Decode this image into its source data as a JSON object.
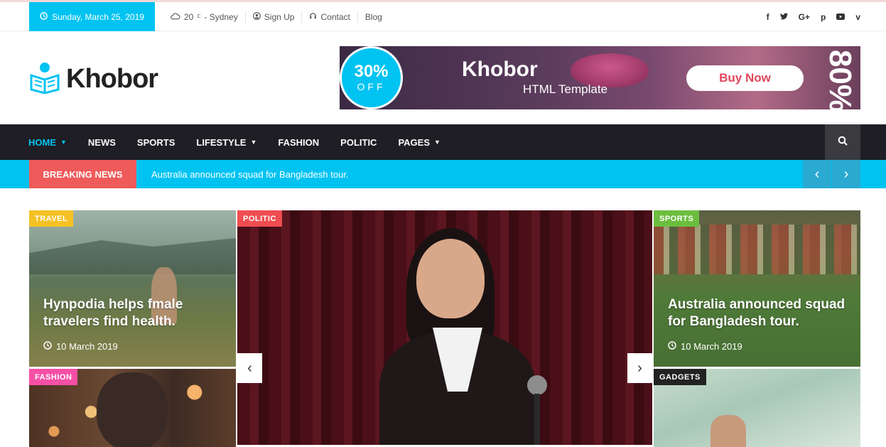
{
  "topbar": {
    "date": "Sunday, March 25, 2019",
    "weather": "20",
    "weather_unit": "C",
    "city": "- Sydney",
    "signup": "Sign Up",
    "contact": "Contact",
    "blog": "Blog",
    "social": [
      "f",
      "t",
      "G+",
      "p",
      "yt",
      "v"
    ]
  },
  "brand": {
    "name": "Khobor"
  },
  "banner": {
    "percent": "30%",
    "off": "OFF",
    "title": "Khobor",
    "subtitle": "HTML Template",
    "button": "Buy Now",
    "vertical": "80%"
  },
  "nav": {
    "items": [
      {
        "label": "HOME"
      },
      {
        "label": "NEWS"
      },
      {
        "label": "SPORTS"
      },
      {
        "label": "LIFESTYLE"
      },
      {
        "label": "FASHION"
      },
      {
        "label": "POLITIC"
      },
      {
        "label": "PAGES"
      }
    ]
  },
  "breaking": {
    "label": "BREAKING NEWS",
    "text": "Australia announced squad for Bangladesh tour."
  },
  "cards": {
    "travel": {
      "tag": "TRAVEL",
      "title": "Hynpodia helps fmale travelers find health.",
      "date": "10 March 2019"
    },
    "politic": {
      "tag": "POLITIC"
    },
    "sports": {
      "tag": "SPORTS",
      "title": "Australia announced squad for Bangladesh tour.",
      "date": "10 March 2019"
    },
    "fashion": {
      "tag": "FASHION"
    },
    "gadgets": {
      "tag": "GADGETS"
    }
  },
  "colors": {
    "accent": "#00c3f2",
    "breaking_label": "#ef5a5a",
    "nav_bg": "#1e1e24",
    "tag_travel": "#f4c125",
    "tag_politic": "#ef4d50",
    "tag_sports": "#6bbe3f",
    "tag_fashion": "#f54fa6",
    "tag_gadgets": "#222222"
  }
}
